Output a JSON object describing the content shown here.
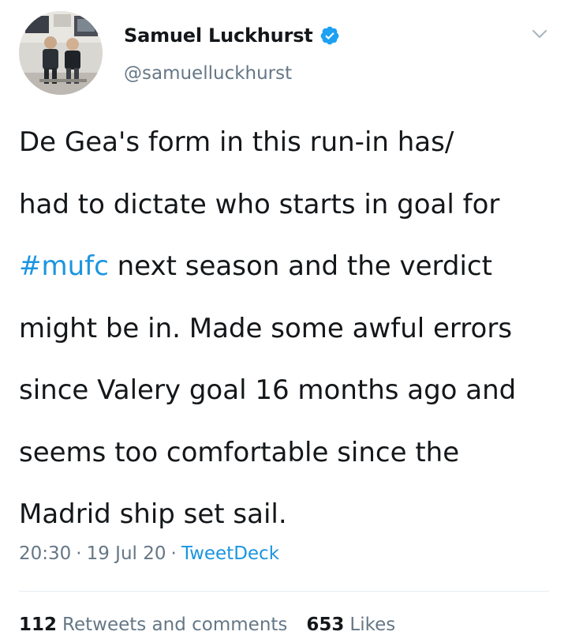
{
  "author": {
    "display_name": "Samuel Luckhurst",
    "handle": "@samuelluckhurst",
    "verified": true
  },
  "tweet": {
    "lines": [
      [
        {
          "text": "De Gea's form in this run-in has/",
          "hashtag": false
        }
      ],
      [
        {
          "text": "had to dictate who starts in goal for",
          "hashtag": false
        }
      ],
      [
        {
          "text": "#mufc",
          "hashtag": true
        },
        {
          "text": " next season and the verdict",
          "hashtag": false
        }
      ],
      [
        {
          "text": "might be in. Made some awful errors",
          "hashtag": false
        }
      ],
      [
        {
          "text": "since Valery goal 16 months ago and",
          "hashtag": false
        }
      ],
      [
        {
          "text": "seems too comfortable since the",
          "hashtag": false
        }
      ],
      [
        {
          "text": "Madrid ship set sail.",
          "hashtag": false
        }
      ]
    ]
  },
  "meta": {
    "time": "20:30",
    "date": "19 Jul 20",
    "separator": "·",
    "source": "TweetDeck"
  },
  "stats": {
    "retweets_count": "112",
    "retweets_label": "Retweets and comments",
    "likes_count": "653",
    "likes_label": "Likes"
  },
  "colors": {
    "text": "#14171a",
    "secondary": "#657786",
    "link": "#1b95e0",
    "verified": "#1da1f2",
    "divider": "#e6ecf0"
  },
  "icons": {
    "verified": "verified-badge-icon",
    "caret": "chevron-down-icon"
  }
}
